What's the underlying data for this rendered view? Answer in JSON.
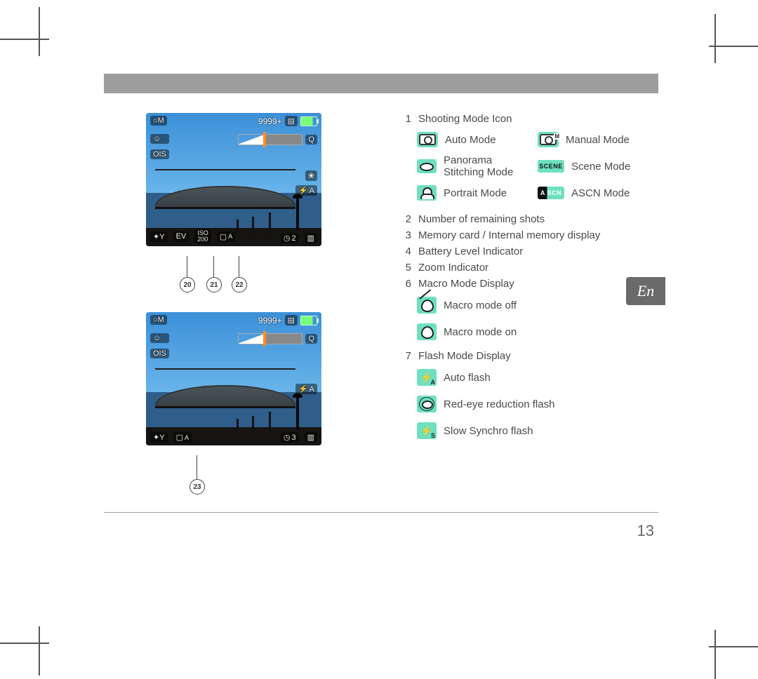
{
  "page": {
    "language_tab": "En",
    "page_number": "13"
  },
  "lcd": {
    "shots_remaining": "9999+",
    "mode_badge": "○M",
    "timer": "2",
    "timer2": "3",
    "iso": "ISO\n200",
    "ev": "EV",
    "ois": "OIS",
    "flash_sub_a": "A",
    "mag": "Q",
    "tools": "✦Y"
  },
  "callouts": {
    "a": "20",
    "b": "21",
    "c": "22",
    "d": "23"
  },
  "legend": {
    "item1": {
      "num": "1",
      "label": "Shooting Mode Icon",
      "modes": {
        "auto": "Auto Mode",
        "manual": "Manual Mode",
        "panorama": "Panorama Stitching Mode",
        "scene": "Scene Mode",
        "portrait": "Portrait Mode",
        "ascn": "ASCN Mode"
      }
    },
    "item2": {
      "num": "2",
      "label": "Number of remaining shots"
    },
    "item3": {
      "num": "3",
      "label": "Memory card / Internal memory display"
    },
    "item4": {
      "num": "4",
      "label": "Battery Level Indicator"
    },
    "item5": {
      "num": "5",
      "label": "Zoom Indicator"
    },
    "item6": {
      "num": "6",
      "label": "Macro Mode Display",
      "options": {
        "off": "Macro mode off",
        "on": "Macro mode on"
      }
    },
    "item7": {
      "num": "7",
      "label": "Flash Mode Display",
      "options": {
        "auto": "Auto flash",
        "redeye": "Red-eye reduction flash",
        "slow": "Slow Synchro flash"
      }
    }
  }
}
